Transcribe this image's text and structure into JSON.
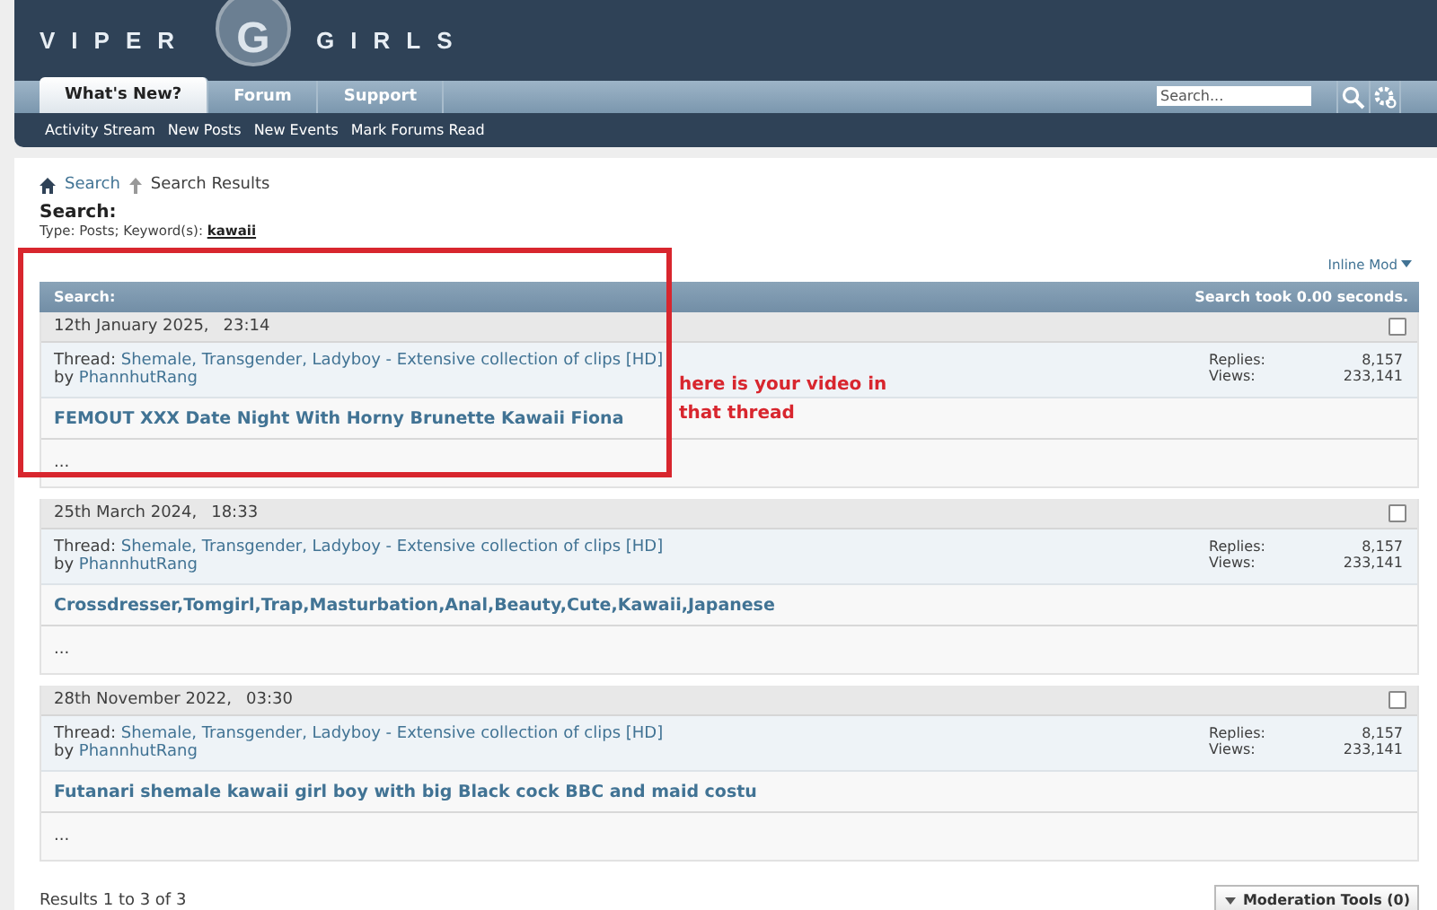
{
  "header": {
    "logo": {
      "left": "VIPER",
      "badge": "G",
      "right": "GIRLS"
    },
    "tabs": [
      {
        "label": "What's New?",
        "selected": true
      },
      {
        "label": "Forum",
        "selected": false
      },
      {
        "label": "Support",
        "selected": false
      }
    ],
    "search": {
      "placeholder": "Search..."
    },
    "subnav": [
      "Activity Stream",
      "New Posts",
      "New Events",
      "Mark Forums Read"
    ]
  },
  "breadcrumb": [
    {
      "label": "Search",
      "kind": "link"
    },
    {
      "label": "Search Results",
      "kind": "current"
    }
  ],
  "search_summary": {
    "title": "Search:",
    "type_label": "Type: Posts; Keyword(s):",
    "keyword": "kawaii"
  },
  "inline_mod": "Inline Mod",
  "results_header": {
    "title": "Search:",
    "timing": "Search took 0.00 seconds."
  },
  "results": [
    {
      "date": "12th January 2025,",
      "time": "23:14",
      "checked": false,
      "thread_label": "Thread:",
      "thread": "Shemale, Transgender, Ladyboy - Extensive collection of clips [HD]",
      "by": "by",
      "author": "PhannhutRang",
      "stats": [
        {
          "label": "Replies:",
          "value": "8,157"
        },
        {
          "label": "Views:",
          "value": "233,141"
        }
      ],
      "title": "FEMOUT XXX Date Night With Horny Brunette Kawaii Fiona",
      "snippet": "..."
    },
    {
      "date": "25th March 2024,",
      "time": "18:33",
      "checked": false,
      "thread_label": "Thread:",
      "thread": "Shemale, Transgender, Ladyboy - Extensive collection of clips [HD]",
      "by": "by",
      "author": "PhannhutRang",
      "stats": [
        {
          "label": "Replies:",
          "value": "8,157"
        },
        {
          "label": "Views:",
          "value": "233,141"
        }
      ],
      "title": "Crossdresser,Tomgirl,Trap,Masturbation,Anal,Beauty,Cute,Kawaii,Japanese",
      "snippet": "..."
    },
    {
      "date": "28th November 2022,",
      "time": "03:30",
      "checked": false,
      "thread_label": "Thread:",
      "thread": "Shemale, Transgender, Ladyboy - Extensive collection of clips [HD]",
      "by": "by",
      "author": "PhannhutRang",
      "stats": [
        {
          "label": "Replies:",
          "value": "8,157"
        },
        {
          "label": "Views:",
          "value": "233,141"
        }
      ],
      "title": "Futanari shemale kawaii girl boy with big Black cock BBC and maid costu",
      "snippet": "..."
    }
  ],
  "results_count": "Results 1 to 3 of 3",
  "moderation_button": "Moderation Tools (0)",
  "annotation": {
    "lines": [
      "here is your video in",
      "that thread"
    ]
  }
}
